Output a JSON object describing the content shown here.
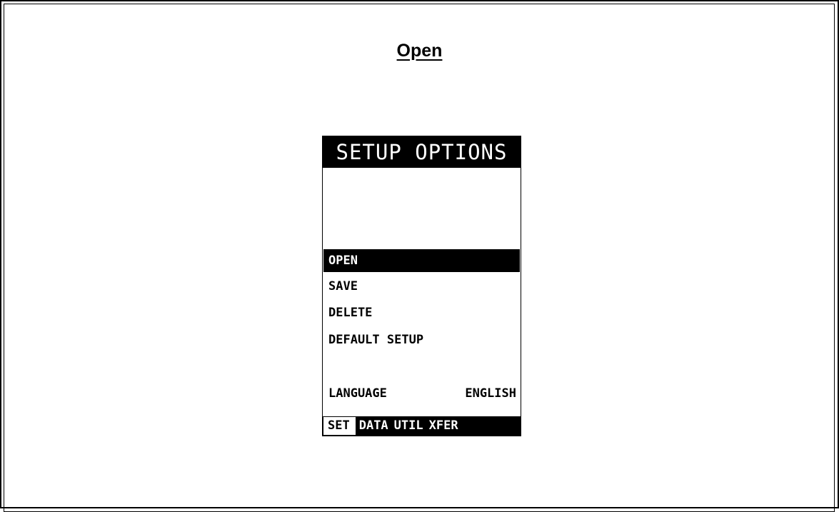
{
  "page": {
    "title": "Open"
  },
  "device": {
    "header": "SETUP OPTIONS",
    "menu": [
      {
        "label": "OPEN",
        "selected": true
      },
      {
        "label": "SAVE",
        "selected": false
      },
      {
        "label": "DELETE",
        "selected": false
      },
      {
        "label": "DEFAULT SETUP",
        "selected": false
      }
    ],
    "language": {
      "label": "LANGUAGE",
      "value": "ENGLISH"
    },
    "tabs": [
      {
        "label": "SET",
        "active": true
      },
      {
        "label": "DATA",
        "active": false
      },
      {
        "label": "UTIL",
        "active": false
      },
      {
        "label": "XFER",
        "active": false
      }
    ]
  }
}
